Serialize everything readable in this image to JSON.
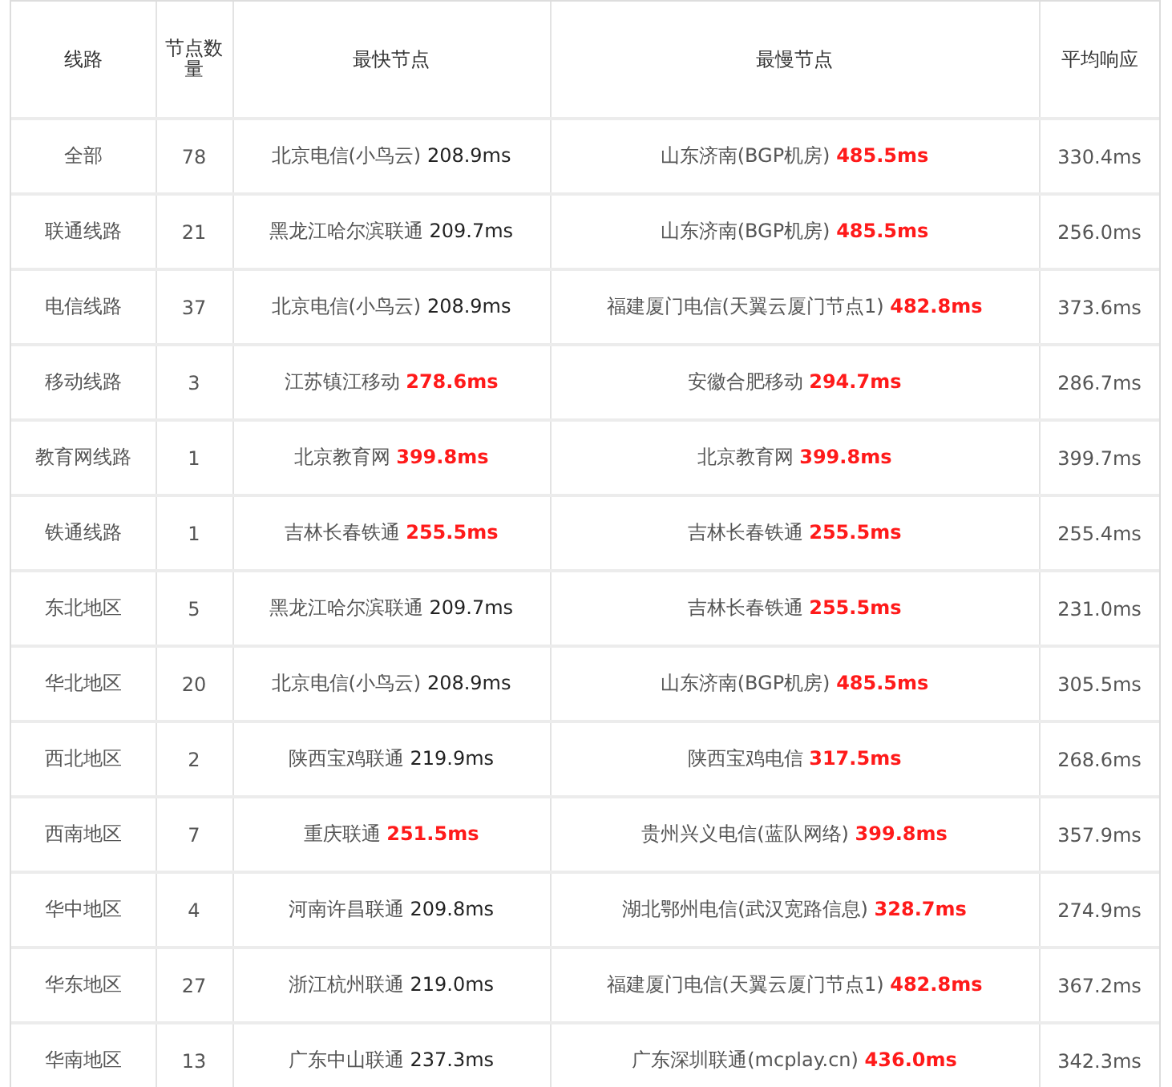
{
  "table": {
    "columns": [
      "线路",
      "节点数量",
      "最快节点",
      "最慢节点",
      "平均响应"
    ],
    "rows": [
      {
        "route": "全部",
        "count": "78",
        "fastest": {
          "node": "北京电信(小鸟云)",
          "latency": "208.9ms",
          "slow": false
        },
        "slowest": {
          "node": "山东济南(BGP机房)",
          "latency": "485.5ms",
          "slow": true
        },
        "average": "330.4ms"
      },
      {
        "route": "联通线路",
        "count": "21",
        "fastest": {
          "node": "黑龙江哈尔滨联通",
          "latency": "209.7ms",
          "slow": false
        },
        "slowest": {
          "node": "山东济南(BGP机房)",
          "latency": "485.5ms",
          "slow": true
        },
        "average": "256.0ms"
      },
      {
        "route": "电信线路",
        "count": "37",
        "fastest": {
          "node": "北京电信(小鸟云)",
          "latency": "208.9ms",
          "slow": false
        },
        "slowest": {
          "node": "福建厦门电信(天翼云厦门节点1)",
          "latency": "482.8ms",
          "slow": true
        },
        "average": "373.6ms"
      },
      {
        "route": "移动线路",
        "count": "3",
        "fastest": {
          "node": "江苏镇江移动",
          "latency": "278.6ms",
          "slow": true
        },
        "slowest": {
          "node": "安徽合肥移动",
          "latency": "294.7ms",
          "slow": true
        },
        "average": "286.7ms"
      },
      {
        "route": "教育网线路",
        "count": "1",
        "fastest": {
          "node": "北京教育网",
          "latency": "399.8ms",
          "slow": true
        },
        "slowest": {
          "node": "北京教育网",
          "latency": "399.8ms",
          "slow": true
        },
        "average": "399.7ms"
      },
      {
        "route": "铁通线路",
        "count": "1",
        "fastest": {
          "node": "吉林长春铁通",
          "latency": "255.5ms",
          "slow": true
        },
        "slowest": {
          "node": "吉林长春铁通",
          "latency": "255.5ms",
          "slow": true
        },
        "average": "255.4ms"
      },
      {
        "route": "东北地区",
        "count": "5",
        "fastest": {
          "node": "黑龙江哈尔滨联通",
          "latency": "209.7ms",
          "slow": false
        },
        "slowest": {
          "node": "吉林长春铁通",
          "latency": "255.5ms",
          "slow": true
        },
        "average": "231.0ms"
      },
      {
        "route": "华北地区",
        "count": "20",
        "fastest": {
          "node": "北京电信(小鸟云)",
          "latency": "208.9ms",
          "slow": false
        },
        "slowest": {
          "node": "山东济南(BGP机房)",
          "latency": "485.5ms",
          "slow": true
        },
        "average": "305.5ms"
      },
      {
        "route": "西北地区",
        "count": "2",
        "fastest": {
          "node": "陕西宝鸡联通",
          "latency": "219.9ms",
          "slow": false
        },
        "slowest": {
          "node": "陕西宝鸡电信",
          "latency": "317.5ms",
          "slow": true
        },
        "average": "268.6ms"
      },
      {
        "route": "西南地区",
        "count": "7",
        "fastest": {
          "node": "重庆联通",
          "latency": "251.5ms",
          "slow": true
        },
        "slowest": {
          "node": "贵州兴义电信(蓝队网络)",
          "latency": "399.8ms",
          "slow": true
        },
        "average": "357.9ms"
      },
      {
        "route": "华中地区",
        "count": "4",
        "fastest": {
          "node": "河南许昌联通",
          "latency": "209.8ms",
          "slow": false
        },
        "slowest": {
          "node": "湖北鄂州电信(武汉宽路信息)",
          "latency": "328.7ms",
          "slow": true
        },
        "average": "274.9ms"
      },
      {
        "route": "华东地区",
        "count": "27",
        "fastest": {
          "node": "浙江杭州联通",
          "latency": "219.0ms",
          "slow": false
        },
        "slowest": {
          "node": "福建厦门电信(天翼云厦门节点1)",
          "latency": "482.8ms",
          "slow": true
        },
        "average": "367.2ms"
      },
      {
        "route": "华南地区",
        "count": "13",
        "fastest": {
          "node": "广东中山联通",
          "latency": "237.3ms",
          "slow": false
        },
        "slowest": {
          "node": "广东深圳联通(mcplay.cn)",
          "latency": "436.0ms",
          "slow": true
        },
        "average": "342.3ms"
      }
    ]
  }
}
